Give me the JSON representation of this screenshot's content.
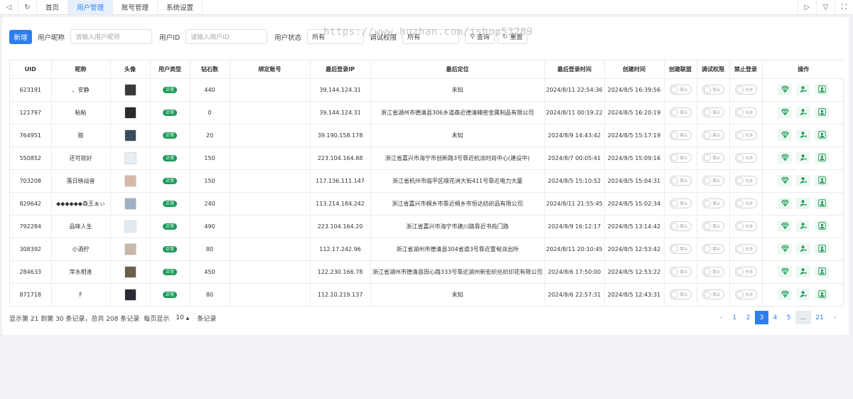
{
  "topbar": {
    "tabs": [
      {
        "label": "首页",
        "active": false
      },
      {
        "label": "用户管理",
        "active": true
      },
      {
        "label": "账号管理",
        "active": false
      },
      {
        "label": "系统设置",
        "active": false
      }
    ]
  },
  "filters": {
    "add_label": "新增",
    "nickname_label": "用户昵称",
    "nickname_placeholder": "请输入用户昵称",
    "uid_label": "用户ID",
    "uid_placeholder": "请输入用户ID",
    "status_label": "用户状态",
    "status_value": "所有",
    "debug_label": "调试权限",
    "debug_value": "所有",
    "search_label": "查询",
    "reset_label": "重置"
  },
  "watermark": "https://www.huzhan.com/ishop53289",
  "table": {
    "columns": [
      "UID",
      "昵称",
      "头像",
      "用户类型",
      "钻石数",
      "绑定账号",
      "最后登录IP",
      "最后定位",
      "最后登录时间",
      "创建时间",
      "创建联盟",
      "调试权限",
      "禁止登录",
      "操作"
    ],
    "rows": [
      {
        "uid": "623191",
        "nick": "、安静",
        "type": "正常",
        "diamonds": "440",
        "account": "",
        "ip": "39.144.124.31",
        "loc": "未知",
        "last_login": "2024/8/11 22:54:36",
        "created": "2024/8/5 16:39:56",
        "t1": "禁止",
        "t2": "禁止",
        "t3": "允许"
      },
      {
        "uid": "121797",
        "nick": "粘粘",
        "type": "正常",
        "diamonds": "0",
        "account": "",
        "ip": "39.144.124.31",
        "loc": "浙江省湖州市德清县306乡道森近德清精密金属制品有限公司",
        "last_login": "2024/8/11 00:19:22",
        "created": "2024/8/5 16:20:19",
        "t1": "禁止",
        "t2": "禁止",
        "t3": "允许"
      },
      {
        "uid": "764951",
        "nick": "狼",
        "type": "正常",
        "diamonds": "20",
        "account": "",
        "ip": "39.190.158.178",
        "loc": "未知",
        "last_login": "2024/8/9 14:43:42",
        "created": "2024/8/5 15:17:19",
        "t1": "禁止",
        "t2": "禁止",
        "t3": "允许"
      },
      {
        "uid": "550852",
        "nick": "还可就好",
        "type": "正常",
        "diamonds": "150",
        "account": "",
        "ip": "223.104.164.88",
        "loc": "浙江省嘉兴市海宁市创新路3号靠近杭派时尚中心(建设中)",
        "last_login": "2024/8/7 00:05:41",
        "created": "2024/8/5 15:09:16",
        "t1": "禁止",
        "t2": "禁止",
        "t3": "允许"
      },
      {
        "uid": "703208",
        "nick": "落日映战音",
        "type": "正常",
        "diamonds": "150",
        "account": "",
        "ip": "117.136.111.147",
        "loc": "浙江省杭州市临平区顺花洲大街411号靠近电力大厦",
        "last_login": "2024/8/5 15:10:52",
        "created": "2024/8/5 15:04:31",
        "t1": "禁止",
        "t2": "禁止",
        "t3": "允许"
      },
      {
        "uid": "829642",
        "nick": "◆◆◆◆◆◆森王ぁぃ",
        "type": "正常",
        "diamonds": "240",
        "account": "",
        "ip": "113.214.184.242",
        "loc": "浙江省嘉兴市桐乡市靠近桐乡市恒达纺织品有限公司",
        "last_login": "2024/8/11 21:55:45",
        "created": "2024/8/5 15:02:34",
        "t1": "禁止",
        "t2": "禁止",
        "t3": "允许"
      },
      {
        "uid": "792284",
        "nick": "品味人生",
        "type": "正常",
        "diamonds": "490",
        "account": "",
        "ip": "223.104.164.20",
        "loc": "浙江省嘉兴市海宁市建川路靠近书苑门路",
        "last_login": "2024/8/9 16:12:17",
        "created": "2024/8/5 13:14:42",
        "t1": "禁止",
        "t2": "禁止",
        "t3": "允许"
      },
      {
        "uid": "308392",
        "nick": "小酒柠",
        "type": "正常",
        "diamonds": "80",
        "account": "",
        "ip": "112.17.242.96",
        "loc": "浙江省湖州市德清县304省道3号靠近雷甸派出所",
        "last_login": "2024/8/11 20:10:45",
        "created": "2024/8/5 12:53:42",
        "t1": "禁止",
        "t2": "禁止",
        "t3": "允许"
      },
      {
        "uid": "284633",
        "nick": "萍水相逢",
        "type": "正常",
        "diamonds": "450",
        "account": "",
        "ip": "122.230.166.78",
        "loc": "浙江省湖州市德清县田心路333号靠近湖州新宏织丝织印花有限公司",
        "last_login": "2024/8/6 17:50:00",
        "created": "2024/8/5 12:53:22",
        "t1": "禁止",
        "t2": "禁止",
        "t3": "允许"
      },
      {
        "uid": "871718",
        "nick": "F",
        "type": "正常",
        "diamonds": "80",
        "account": "",
        "ip": "112.10.219.137",
        "loc": "未知",
        "last_login": "2024/8/6 22:57:31",
        "created": "2024/8/5 12:43:31",
        "t1": "禁止",
        "t2": "禁止",
        "t3": "允许"
      }
    ]
  },
  "footer": {
    "summary": "显示第 21 到第 30 条记录，总共 208 条记录",
    "per_page_prefix": "每页显示",
    "page_size": "10",
    "per_page_suffix": "条记录"
  },
  "pagination": {
    "prev": "‹",
    "pages": [
      "1",
      "2",
      "3",
      "4",
      "5"
    ],
    "current": "3",
    "ellipsis": "...",
    "last": "21",
    "next": "›"
  },
  "colors": {
    "accent": "#2d7ff0",
    "badge": "#1e9a5a",
    "action_icon": "#1e9a5a"
  },
  "icons": {
    "row_actions": [
      "diamond-icon",
      "user-edit-icon",
      "user-manage-icon"
    ]
  }
}
